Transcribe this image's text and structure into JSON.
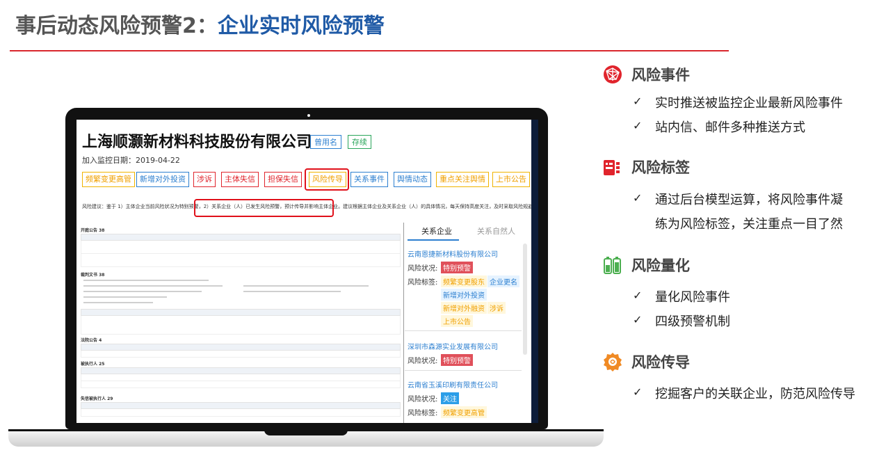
{
  "slide": {
    "title_prefix": "事后动态风险预警2：",
    "title_main": "企业实时风险预警"
  },
  "screen": {
    "company_name": "上海顺灏新材料科技股份有限公司",
    "tag_used_name": "曾用名",
    "tag_status": "存续",
    "monitor_date": "加入监控日期：2019-04-22",
    "chips": [
      "频繁变更高管",
      "新增对外投资",
      "涉诉",
      "主体失信",
      "担保失信",
      "风险传导",
      "关系事件",
      "舆情动态",
      "重点关注舆情",
      "上市公告"
    ],
    "advice_pre": "风险建议：鉴于 1）主体企业当前风险状况为特别预警，",
    "advice_highlight": "2）关系企业（人）已发生风险预警，预计传导并影响主体企业。",
    "advice_post": "建议根据主体企业及关系企业（人）的具体情况，每天保持高度关注，及时采取风险规避措施。",
    "doc_sections": [
      "开庭公告 38",
      "裁判文书 38",
      "法院公告 4",
      "被执行人 25",
      "失信被执行人 29"
    ],
    "side": {
      "tab_a": "关系企业",
      "tab_b": "关系自然人",
      "status_label": "风险状况:",
      "tags_label": "风险标签:",
      "companies": [
        {
          "name": "云南恩捷新材料股份有限公司",
          "status": "特别预警",
          "tags": [
            "频繁变更股东",
            "企业更名",
            "新增对外投资",
            "新增对外融资",
            "涉诉",
            "上市公告"
          ]
        },
        {
          "name": "深圳市森源实业发展有限公司",
          "status": "特别预警",
          "tags": []
        },
        {
          "name": "云南省玉溪印刷有限责任公司",
          "status": "关注",
          "tags": [
            "频繁变更高管"
          ]
        }
      ]
    }
  },
  "features": [
    {
      "title": "风险事件",
      "icon": "globe-network-icon",
      "bullets": [
        "实时推送被监控企业最新风险事件",
        "站内信、邮件多种推送方式"
      ]
    },
    {
      "title": "风险标签",
      "icon": "tag-icon",
      "bullets": [
        "通过后台模型运算，将风险事件凝",
        "练为风险标签，关注重点一目了然"
      ]
    },
    {
      "title": "风险量化",
      "icon": "battery-icon",
      "bullets": [
        "量化风险事件",
        "四级预警机制"
      ]
    },
    {
      "title": "风险传导",
      "icon": "gear-brain-icon",
      "bullets": [
        "挖掘客户的关联企业，防范风险传导"
      ]
    }
  ],
  "colors": {
    "accent_red": "#d9262c",
    "title_blue": "#1f5aa6",
    "feature_red": "#e0242c",
    "feature_green": "#4caf50",
    "feature_orange": "#f08a24"
  }
}
